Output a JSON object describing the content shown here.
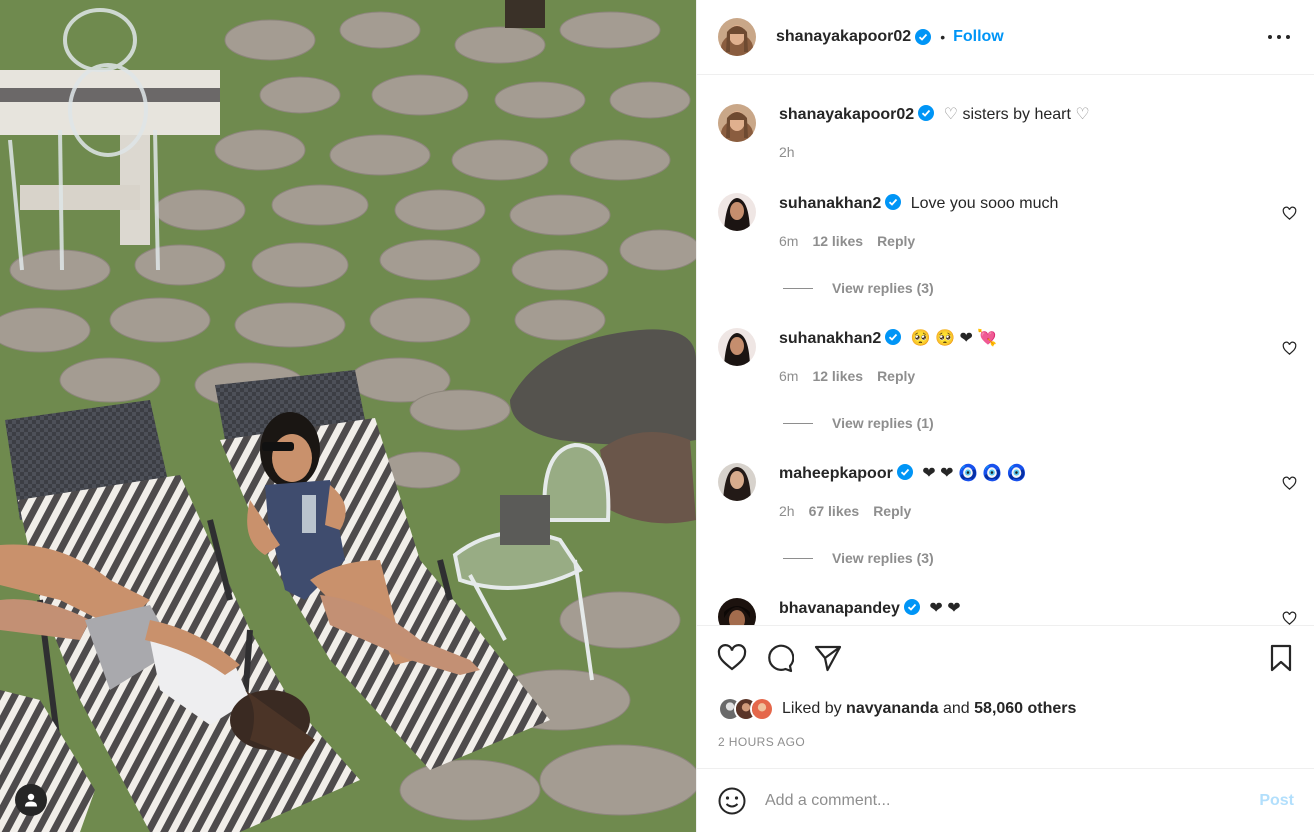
{
  "post": {
    "author": "shanayakapoor02",
    "follow_label": "Follow",
    "separator": "•",
    "caption": "sisters by heart",
    "caption_time": "2h",
    "more_icon": "more-horizontal-icon"
  },
  "comments": [
    {
      "username": "suhanakhan2",
      "text": "Love you sooo much",
      "time": "6m",
      "likes": "12 likes",
      "reply": "Reply",
      "view_replies": "View replies (3)"
    },
    {
      "username": "suhanakhan2",
      "text": "🥺 🥺 ❤ 💘",
      "time": "6m",
      "likes": "12 likes",
      "reply": "Reply",
      "view_replies": "View replies (1)"
    },
    {
      "username": "maheepkapoor",
      "text": "❤ ❤ 🧿 🧿 🧿",
      "time": "2h",
      "likes": "67 likes",
      "reply": "Reply",
      "view_replies": "View replies (3)"
    },
    {
      "username": "bhavanapandey",
      "text": "❤ ❤"
    }
  ],
  "likes": {
    "prefix": "Liked by",
    "user": "navyananda",
    "conj": "and",
    "others": "58,060 others"
  },
  "time_ago": "2 HOURS AGO",
  "composer": {
    "placeholder": "Add a comment...",
    "post_label": "Post"
  },
  "colors": {
    "accent": "#0095f6",
    "post_disabled": "#b2dffc",
    "muted": "#8e8e8e",
    "heart_red": "#ed1c3c"
  }
}
